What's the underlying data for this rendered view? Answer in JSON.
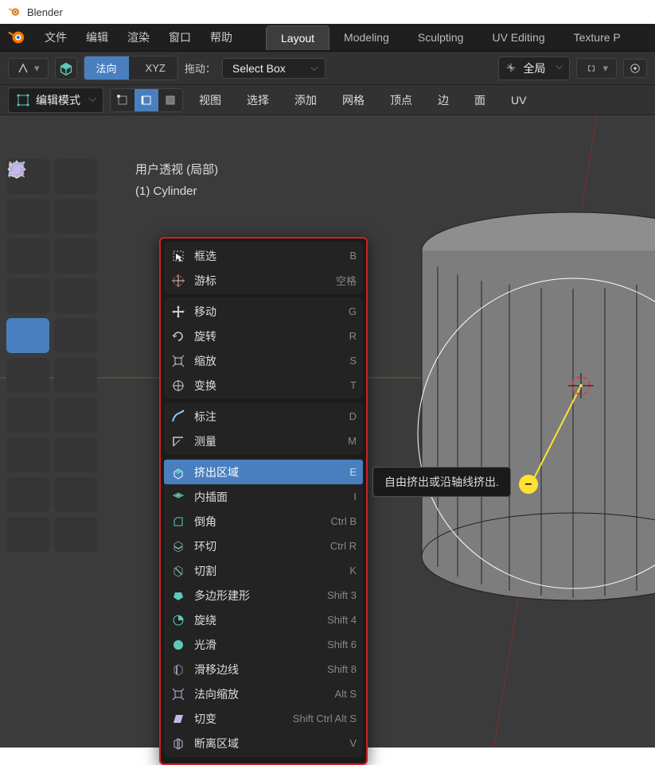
{
  "title": "Blender",
  "top_menu": [
    "文件",
    "编辑",
    "渲染",
    "窗口",
    "帮助"
  ],
  "workspaces": [
    "Layout",
    "Modeling",
    "Sculpting",
    "UV Editing",
    "Texture P"
  ],
  "active_workspace": 0,
  "option_row": {
    "orient_a": "法向",
    "orient_b": "XYZ",
    "drag_label": "拖动：",
    "select_mode": "Select Box",
    "transform_orient": "全局"
  },
  "header": {
    "mode": "编辑模式",
    "menus": [
      "视图",
      "选择",
      "添加",
      "网格",
      "顶点",
      "边",
      "面",
      "UV"
    ]
  },
  "info": {
    "persp": "用户透视 (局部)",
    "obj": "(1) Cylinder"
  },
  "tooltip": "自由挤出或沿轴线挤出.",
  "context_menu": {
    "groups": [
      [
        {
          "icon": "box-select",
          "label": "框选",
          "shortcut": "B"
        },
        {
          "icon": "cursor",
          "label": "游标",
          "shortcut": "空格"
        }
      ],
      [
        {
          "icon": "move",
          "label": "移动",
          "shortcut": "G"
        },
        {
          "icon": "rotate",
          "label": "旋转",
          "shortcut": "R"
        },
        {
          "icon": "scale",
          "label": "缩放",
          "shortcut": "S"
        },
        {
          "icon": "transform",
          "label": "变换",
          "shortcut": "T"
        }
      ],
      [
        {
          "icon": "annotate",
          "label": "标注",
          "shortcut": "D"
        },
        {
          "icon": "measure",
          "label": "测量",
          "shortcut": "M"
        }
      ],
      [
        {
          "icon": "extrude",
          "label": "挤出区域",
          "shortcut": "E",
          "selected": true
        },
        {
          "icon": "inset",
          "label": "内插面",
          "shortcut": "I"
        },
        {
          "icon": "bevel",
          "label": "倒角",
          "shortcut": "Ctrl B"
        },
        {
          "icon": "loopcut",
          "label": "环切",
          "shortcut": "Ctrl R"
        },
        {
          "icon": "knife",
          "label": "切割",
          "shortcut": "K"
        },
        {
          "icon": "polybuild",
          "label": "多边形建形",
          "shortcut": "Shift 3"
        },
        {
          "icon": "spin",
          "label": "旋绕",
          "shortcut": "Shift 4"
        },
        {
          "icon": "smooth",
          "label": "光滑",
          "shortcut": "Shift 6"
        },
        {
          "icon": "edgeslide",
          "label": "滑移边线",
          "shortcut": "Shift 8"
        },
        {
          "icon": "shrink",
          "label": "法向缩放",
          "shortcut": "Alt S"
        },
        {
          "icon": "shear",
          "label": "切变",
          "shortcut": "Shift Ctrl Alt S"
        },
        {
          "icon": "rip",
          "label": "断离区域",
          "shortcut": "V"
        }
      ]
    ]
  },
  "colors": {
    "accent": "#4a7fbf",
    "red_border": "#c22",
    "teal": "#5dc9b9",
    "lilac": "#c7b6e8",
    "yellow": "#ffe033"
  }
}
